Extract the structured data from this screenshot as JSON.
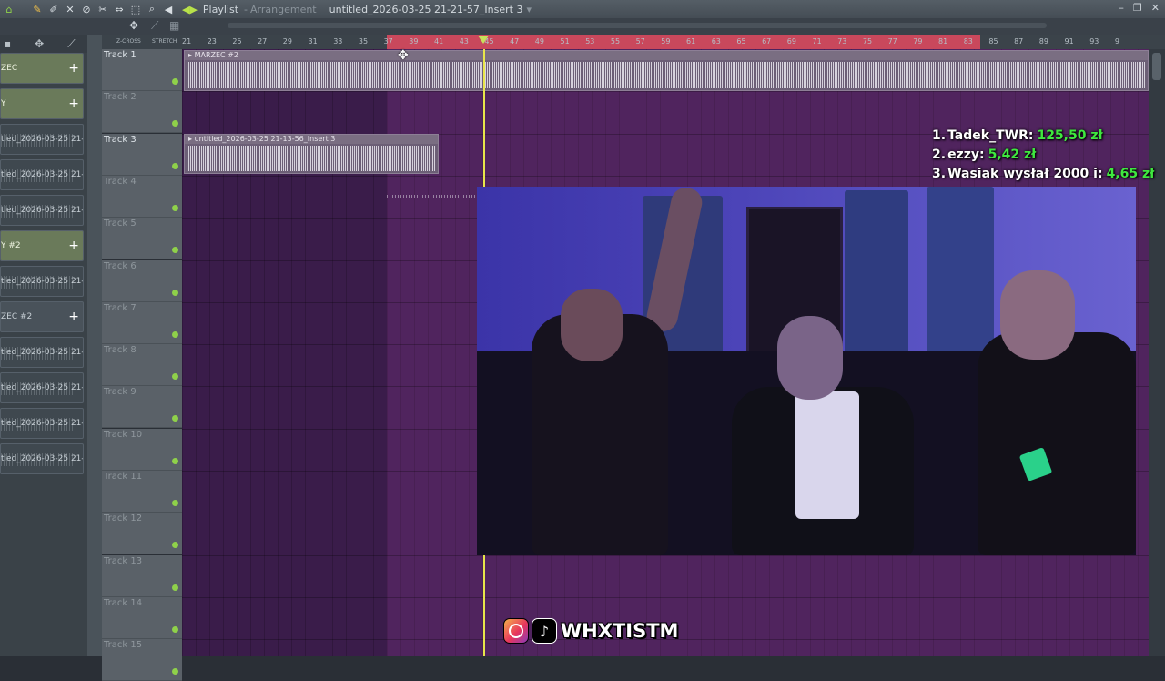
{
  "titlebar": {
    "playlist_label": "Playlist",
    "arrangement_label": "Arrangement",
    "file_name": "untitled_2026-03-25 21-21-57_Insert 3",
    "dropdown_caret": "▾"
  },
  "ruler": {
    "zcross_label": "Z-CROSS",
    "stretch_label": "STRETCH",
    "numbers": [
      "21",
      "23",
      "25",
      "27",
      "29",
      "31",
      "33",
      "35",
      "37",
      "39",
      "41",
      "43",
      "45",
      "47",
      "49",
      "51",
      "53",
      "55",
      "57",
      "59",
      "61",
      "63",
      "65",
      "67",
      "69",
      "71",
      "73",
      "75",
      "77",
      "79",
      "81",
      "83",
      "85",
      "87",
      "89",
      "91",
      "93",
      "9"
    ]
  },
  "sidebar_clips": [
    {
      "label": "ZEC",
      "type": "audio",
      "plus": "+"
    },
    {
      "label": "Y",
      "type": "audio",
      "plus": "+"
    },
    {
      "label": "tled_2026-03-25 21-...",
      "type": "wave"
    },
    {
      "label": "tled_2026-03-25 21-...",
      "type": "wave"
    },
    {
      "label": "tled_2026-03-25 21-...",
      "type": "wave"
    },
    {
      "label": "Y #2",
      "type": "audio",
      "plus": "+"
    },
    {
      "label": "tled_2026-03-25 21-...",
      "type": "wave"
    },
    {
      "label": "ZEC #2",
      "type": "sel",
      "plus": "+"
    },
    {
      "label": "tled_2026-03-25 21-...",
      "type": "wave"
    },
    {
      "label": "tled_2026-03-25 21-...",
      "type": "wave"
    },
    {
      "label": "tled_2026-03-25 21-...",
      "type": "wave"
    },
    {
      "label": "tled_2026-03-25 21-...",
      "type": "wave"
    }
  ],
  "tracks": [
    "Track 1",
    "Track 2",
    "Track 3",
    "Track 4",
    "Track 5",
    "Track 6",
    "Track 7",
    "Track 8",
    "Track 9",
    "Track 10",
    "Track 11",
    "Track 12",
    "Track 13",
    "Track 14",
    "Track 15"
  ],
  "clips": {
    "clip1_name": "MARZEC #2",
    "clip2_name": "untitled_2026-03-25 21-13-56_Insert 3"
  },
  "donations": [
    {
      "rank": "1.",
      "name": "Tadek_TWR:",
      "amount": "125,50 zł"
    },
    {
      "rank": "2.",
      "name": "ezzy:",
      "amount": "5,42 zł"
    },
    {
      "rank": "3.",
      "name": "Wasiak wysłał 2000 i:",
      "amount": "4,65 zł"
    }
  ],
  "social": {
    "handle": "WHXTISTM",
    "instagram_icon": "instagram-icon",
    "tiktok_icon": "tiktok-icon"
  },
  "colors": {
    "playlist_bg": "#3a1c4a",
    "selection": "#c9485c",
    "playhead": "#e7e64a",
    "donation_amount": "#3fe83f"
  }
}
